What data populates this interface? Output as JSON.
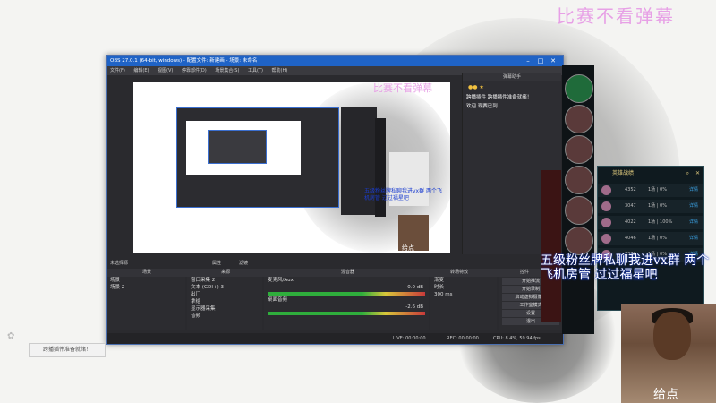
{
  "stream": {
    "title": "比赛不看弹幕",
    "overlay_text": "五级粉丝牌私聊我进vx群 两个飞机房管 过过福星吧",
    "cam_label": "给点",
    "toast": "跨播插件准备就绪！"
  },
  "obs": {
    "title": "OBS 27.0.1 (64-bit, windows) - 配置文件: 新建画 - 场景: 未命名",
    "menu": [
      "文件(F)",
      "编辑(E)",
      "视图(V)",
      "停靠部件(D)",
      "场景集合(S)",
      "工具(T)",
      "帮助(H)"
    ],
    "preview_watermark": "比赛不看弹幕",
    "preview_overlay": "五级粉丝牌私聊我进vx群 两个飞机房管 过过福星吧",
    "preview_cam_label": "给点",
    "chat_title": "弹幕助手",
    "chat_lines": [
      "跨播插件 跨播插件准备就绪！",
      "欢迎 观赛已到"
    ],
    "no_source_selected": "未选择源",
    "props_label": "属性",
    "filters_label": "滤镜",
    "docks": {
      "scenes_title": "场景",
      "sources_title": "来源",
      "mixer_title": "混音器",
      "transitions_title": "转场特效",
      "controls_title": "控件"
    },
    "scenes": [
      "场景",
      "场景 2"
    ],
    "sources": [
      "窗口采集 2",
      "文本 (GDI+) 3",
      "出门",
      "拿给",
      "显示器采集",
      "音频"
    ],
    "mixer": [
      {
        "name": "麦克风/Aux",
        "db": "0.0 dB"
      },
      {
        "name": "桌面音频",
        "db": "-2.6 dB"
      }
    ],
    "transitions": {
      "type": "渐变",
      "duration_label": "时长",
      "duration": "300 ms"
    },
    "controls": [
      "开始推流",
      "开始录制",
      "启动虚拟摄像机",
      "工作室模式",
      "设置",
      "退出"
    ],
    "status": {
      "live": "LIVE: 00:00:00",
      "rec": "REC: 00:00:00",
      "cpu": "CPU: 8.4%, 59.94 fps"
    }
  },
  "lol": {
    "title": "英雄战绩",
    "rows": [
      {
        "pts": "4352",
        "rank": "1场 | 0%",
        "link": "详情"
      },
      {
        "pts": "3047",
        "rank": "1场 | 0%",
        "link": "详情"
      },
      {
        "pts": "4022",
        "rank": "1场 | 100%",
        "link": "详情"
      },
      {
        "pts": "4046",
        "rank": "1场 | 0%",
        "link": "详情"
      },
      {
        "pts": "7372",
        "rank": "1场 | 0%",
        "link": "详情"
      }
    ]
  },
  "colors": {
    "accent": "#1f63c6",
    "watermark": "#e7a0e6",
    "link": "#3aa0e0"
  }
}
